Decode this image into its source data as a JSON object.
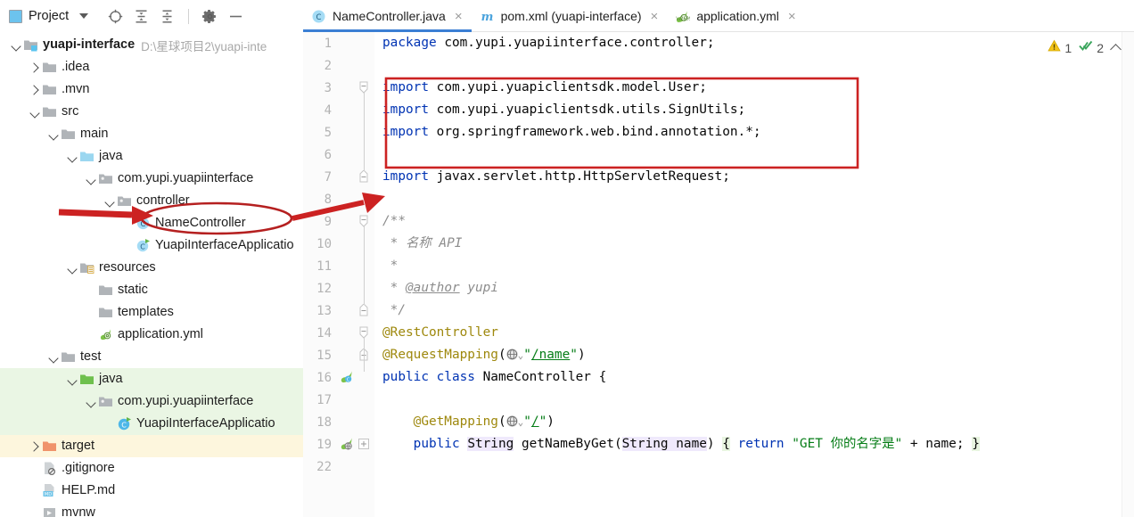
{
  "window": {
    "project_panel": {
      "title": "Project",
      "caret_icon": "chevron-down-icon",
      "toolbar_icons": [
        "locate-target-icon",
        "expand-all-icon",
        "collapse-all-icon",
        "settings-gear-icon",
        "hide-minimize-icon"
      ]
    },
    "tabs": [
      {
        "label": "NameController.java",
        "icon": "java-class-icon",
        "active": true,
        "close": "×"
      },
      {
        "label": "pom.xml (yuapi-interface)",
        "icon": "maven-m-icon",
        "active": false,
        "close": "×"
      },
      {
        "label": "application.yml",
        "icon": "spring-yaml-icon",
        "active": false,
        "close": "×"
      }
    ]
  },
  "tree": [
    {
      "indent": 0,
      "arrow": "down",
      "icon": "module-folder-icon",
      "label": "yuapi-interface",
      "bold": true,
      "path": "D:\\星球项目2\\yuapi-inte",
      "highlight": ""
    },
    {
      "indent": 1,
      "arrow": "right",
      "icon": "folder-icon",
      "label": ".idea",
      "bold": false,
      "path": "",
      "highlight": ""
    },
    {
      "indent": 1,
      "arrow": "right",
      "icon": "folder-icon",
      "label": ".mvn",
      "bold": false,
      "path": "",
      "highlight": ""
    },
    {
      "indent": 1,
      "arrow": "down",
      "icon": "folder-icon",
      "label": "src",
      "bold": false,
      "path": "",
      "highlight": ""
    },
    {
      "indent": 2,
      "arrow": "down",
      "icon": "folder-icon",
      "label": "main",
      "bold": false,
      "path": "",
      "highlight": ""
    },
    {
      "indent": 3,
      "arrow": "down",
      "icon": "source-root-icon",
      "label": "java",
      "bold": false,
      "path": "",
      "highlight": ""
    },
    {
      "indent": 4,
      "arrow": "down",
      "icon": "package-icon",
      "label": "com.yupi.yuapiinterface",
      "bold": false,
      "path": "",
      "highlight": ""
    },
    {
      "indent": 5,
      "arrow": "down",
      "icon": "package-icon",
      "label": "controller",
      "bold": false,
      "path": "",
      "highlight": ""
    },
    {
      "indent": 6,
      "arrow": "none",
      "icon": "java-class-icon",
      "label": "NameController",
      "bold": false,
      "path": "",
      "highlight": ""
    },
    {
      "indent": 6,
      "arrow": "none",
      "icon": "spring-boot-app-icon",
      "label": "YuapiInterfaceApplicatio",
      "bold": false,
      "path": "",
      "highlight": ""
    },
    {
      "indent": 3,
      "arrow": "down",
      "icon": "resources-root-icon",
      "label": "resources",
      "bold": false,
      "path": "",
      "highlight": ""
    },
    {
      "indent": 4,
      "arrow": "none",
      "icon": "folder-icon",
      "label": "static",
      "bold": false,
      "path": "",
      "highlight": ""
    },
    {
      "indent": 4,
      "arrow": "none",
      "icon": "folder-icon",
      "label": "templates",
      "bold": false,
      "path": "",
      "highlight": ""
    },
    {
      "indent": 4,
      "arrow": "none",
      "icon": "spring-yaml-icon",
      "label": "application.yml",
      "bold": false,
      "path": "",
      "highlight": ""
    },
    {
      "indent": 2,
      "arrow": "down",
      "icon": "folder-icon",
      "label": "test",
      "bold": false,
      "path": "",
      "highlight": ""
    },
    {
      "indent": 3,
      "arrow": "down",
      "icon": "test-source-root-icon",
      "label": "java",
      "bold": false,
      "path": "",
      "highlight": "green"
    },
    {
      "indent": 4,
      "arrow": "down",
      "icon": "package-icon",
      "label": "com.yupi.yuapiinterface",
      "bold": false,
      "path": "",
      "highlight": "green"
    },
    {
      "indent": 5,
      "arrow": "none",
      "icon": "test-class-icon",
      "label": "YuapiInterfaceApplicatio",
      "bold": false,
      "path": "",
      "highlight": "green"
    },
    {
      "indent": 1,
      "arrow": "right",
      "icon": "excluded-folder-icon",
      "label": "target",
      "bold": false,
      "path": "",
      "highlight": "yellow"
    },
    {
      "indent": 1,
      "arrow": "none",
      "icon": "gitignore-file-icon",
      "label": ".gitignore",
      "bold": false,
      "path": "",
      "highlight": ""
    },
    {
      "indent": 1,
      "arrow": "none",
      "icon": "markdown-file-icon",
      "label": "HELP.md",
      "bold": false,
      "path": "",
      "highlight": ""
    },
    {
      "indent": 1,
      "arrow": "none",
      "icon": "shell-script-icon",
      "label": "mvnw",
      "bold": false,
      "path": "",
      "highlight": ""
    }
  ],
  "editor": {
    "status": {
      "warning_count": "1",
      "warning_icon": "warning-triangle-icon",
      "ok_count": "2",
      "ok_icon": "inspection-check-icon",
      "collapse_icon": "chevron-up-icon"
    },
    "lines": [
      {
        "num": "1",
        "gutter_icon": "",
        "fold": "",
        "tokens": [
          {
            "t": "package ",
            "c": "kw"
          },
          {
            "t": "com.yupi.yuapiinterface.controller;",
            "c": "plain"
          }
        ]
      },
      {
        "num": "2",
        "gutter_icon": "",
        "fold": "",
        "tokens": []
      },
      {
        "num": "3",
        "gutter_icon": "",
        "fold": "start",
        "tokens": [
          {
            "t": "import ",
            "c": "kw"
          },
          {
            "t": "com.yupi.yuapiclientsdk.model.User;",
            "c": "plain"
          }
        ]
      },
      {
        "num": "4",
        "gutter_icon": "",
        "fold": "",
        "tokens": [
          {
            "t": "import ",
            "c": "kw"
          },
          {
            "t": "com.yupi.yuapiclientsdk.utils.SignUtils;",
            "c": "plain"
          }
        ]
      },
      {
        "num": "5",
        "gutter_icon": "",
        "fold": "",
        "tokens": [
          {
            "t": "import ",
            "c": "kw"
          },
          {
            "t": "org.springframework.web.bind.annotation.*;",
            "c": "plain"
          }
        ]
      },
      {
        "num": "6",
        "gutter_icon": "",
        "fold": "",
        "tokens": []
      },
      {
        "num": "7",
        "gutter_icon": "",
        "fold": "end",
        "tokens": [
          {
            "t": "import ",
            "c": "kw"
          },
          {
            "t": "javax.servlet.http.HttpServletRequest;",
            "c": "plain"
          }
        ]
      },
      {
        "num": "8",
        "gutter_icon": "",
        "fold": "",
        "tokens": []
      },
      {
        "num": "9",
        "gutter_icon": "",
        "fold": "start",
        "tokens": [
          {
            "t": "/**",
            "c": "cmt"
          }
        ]
      },
      {
        "num": "10",
        "gutter_icon": "",
        "fold": "",
        "tokens": [
          {
            "t": " * 名称 API",
            "c": "cmt"
          }
        ]
      },
      {
        "num": "11",
        "gutter_icon": "",
        "fold": "",
        "tokens": [
          {
            "t": " *",
            "c": "cmt"
          }
        ]
      },
      {
        "num": "12",
        "gutter_icon": "",
        "fold": "",
        "tokens": [
          {
            "t": " * ",
            "c": "cmt"
          },
          {
            "t": "@author",
            "c": "cmt-tag"
          },
          {
            "t": " yupi",
            "c": "cmt"
          }
        ]
      },
      {
        "num": "13",
        "gutter_icon": "",
        "fold": "end",
        "tokens": [
          {
            "t": " */",
            "c": "cmt"
          }
        ]
      },
      {
        "num": "14",
        "gutter_icon": "",
        "fold": "start",
        "tokens": [
          {
            "t": "@RestController",
            "c": "anno"
          }
        ]
      },
      {
        "num": "15",
        "gutter_icon": "",
        "fold": "end",
        "tokens": [
          {
            "t": "@RequestMapping",
            "c": "anno"
          },
          {
            "t": "(",
            "c": "plain"
          },
          {
            "t": "__GLOBE__",
            "c": "globe"
          },
          {
            "t": "\"",
            "c": "str"
          },
          {
            "t": "/name",
            "c": "strlink"
          },
          {
            "t": "\"",
            "c": "str"
          },
          {
            "t": ")",
            "c": "plain"
          }
        ]
      },
      {
        "num": "16",
        "gutter_icon": "spring-bean-icon",
        "fold": "",
        "tokens": [
          {
            "t": "public ",
            "c": "kw"
          },
          {
            "t": "class ",
            "c": "kw"
          },
          {
            "t": "NameController ",
            "c": "plain"
          },
          {
            "t": "{",
            "c": "plain"
          }
        ]
      },
      {
        "num": "17",
        "gutter_icon": "",
        "fold": "",
        "tokens": []
      },
      {
        "num": "18",
        "gutter_icon": "",
        "fold": "",
        "tokens": [
          {
            "t": "    @GetMapping",
            "c": "anno"
          },
          {
            "t": "(",
            "c": "plain"
          },
          {
            "t": "__GLOBE__",
            "c": "globe"
          },
          {
            "t": "\"",
            "c": "str"
          },
          {
            "t": "/",
            "c": "strlink"
          },
          {
            "t": "\"",
            "c": "str"
          },
          {
            "t": ")",
            "c": "plain"
          }
        ]
      },
      {
        "num": "19",
        "gutter_icon": "spring-request-mapping-icon",
        "fold": "collapse",
        "tokens": [
          {
            "t": "    public ",
            "c": "kw"
          },
          {
            "t": "String",
            "c": "plain hl-lav"
          },
          {
            "t": " ",
            "c": "plain"
          },
          {
            "t": "getNameByGet",
            "c": "method"
          },
          {
            "t": "(",
            "c": "plain"
          },
          {
            "t": "String",
            "c": "plain hl-lav"
          },
          {
            "t": " name",
            "c": "plain hl-lav"
          },
          {
            "t": ")",
            "c": "plain"
          },
          {
            "t": " ",
            "c": "plain"
          },
          {
            "t": "{",
            "c": "plain hl-grn"
          },
          {
            "t": " ",
            "c": "plain"
          },
          {
            "t": "return",
            "c": "kw"
          },
          {
            "t": " ",
            "c": "plain"
          },
          {
            "t": "\"GET 你的名字是\"",
            "c": "str"
          },
          {
            "t": " + name;",
            "c": "plain"
          },
          {
            "t": " ",
            "c": "plain"
          },
          {
            "t": "}",
            "c": "plain hl-grn"
          }
        ]
      },
      {
        "num": "22",
        "gutter_icon": "",
        "fold": "",
        "tokens": []
      }
    ]
  },
  "annotations": {
    "import_box_color": "#cc2222",
    "arrow_color": "#cc2222",
    "ellipse_color": "#b52020",
    "items": [
      "import-block-highlight-box",
      "tree-arrow-pointer",
      "namecontroller-ellipse",
      "code-arrow-pointer"
    ]
  },
  "colors": {
    "accent_tab": "#3b7fd4",
    "keyword": "#0033b3",
    "string": "#067d17",
    "annotation": "#9e880d",
    "comment": "#8c8c8c",
    "tree_green_highlight": "#eaf6e4",
    "tree_yellow_highlight": "#fdf6dd"
  }
}
